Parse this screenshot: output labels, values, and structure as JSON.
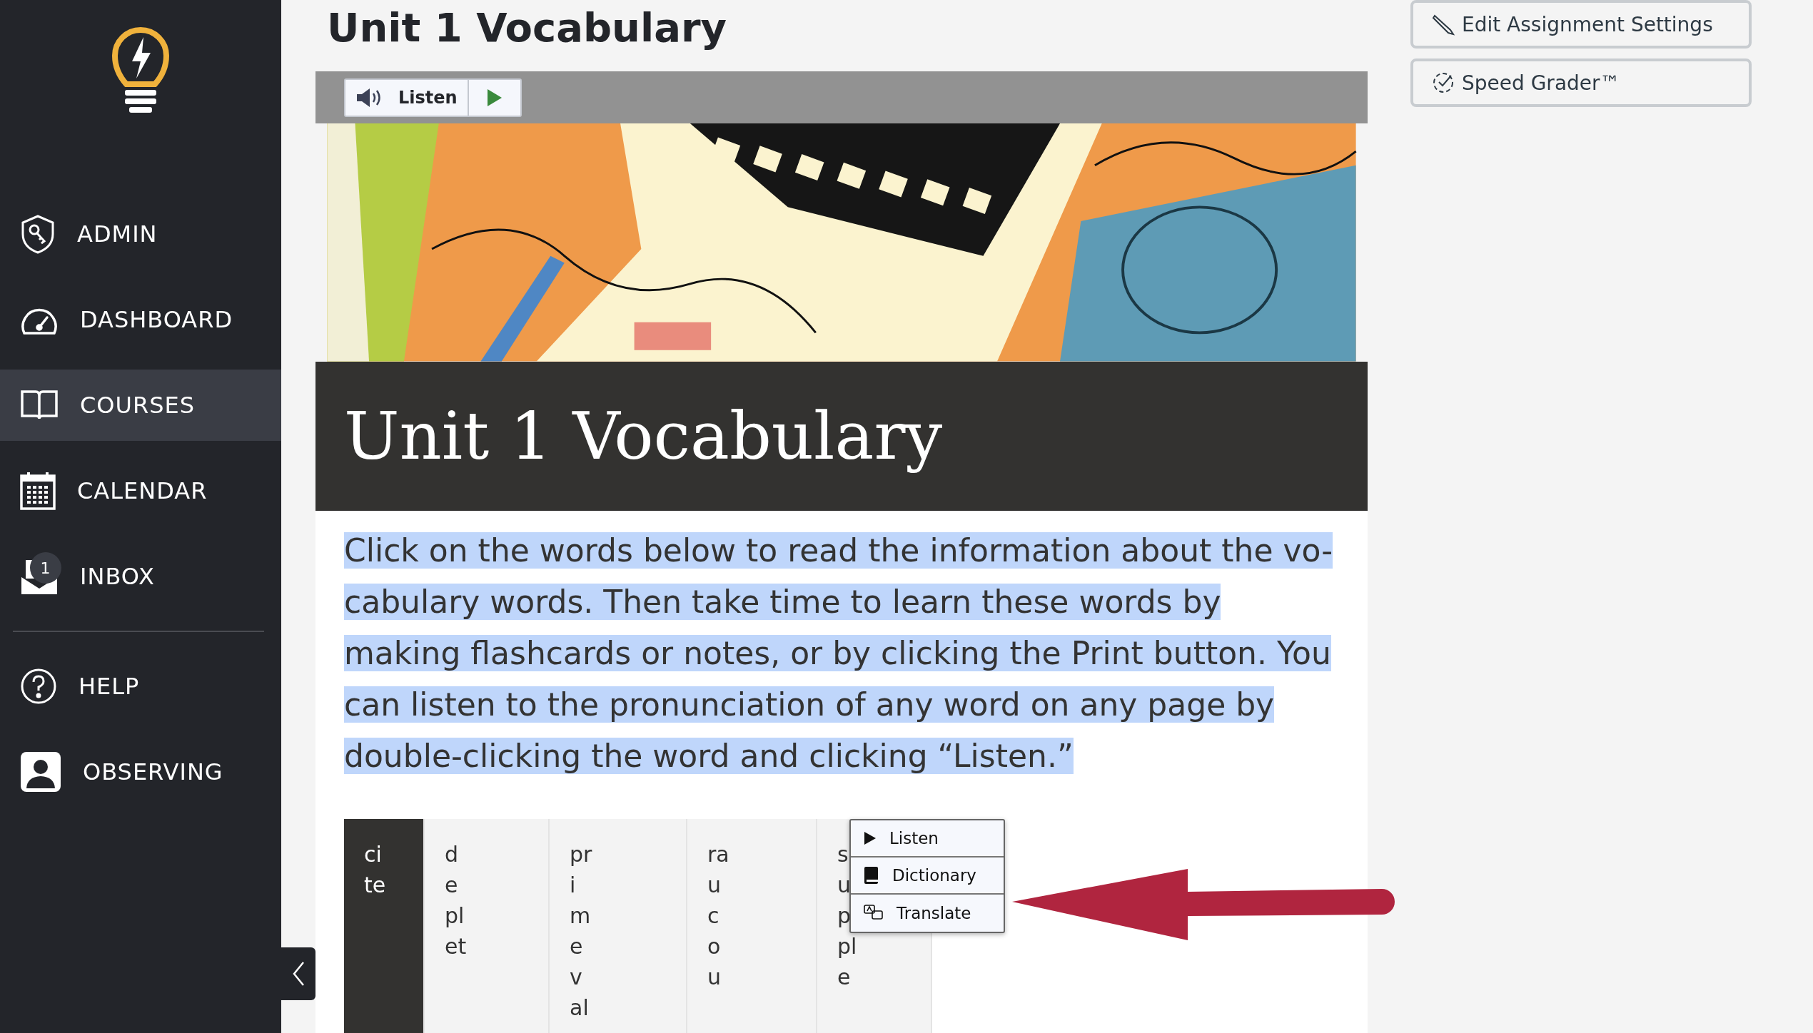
{
  "sidebar": {
    "items": [
      {
        "kind": "admin",
        "label": "ADMIN",
        "selected": false
      },
      {
        "kind": "dashboard",
        "label": "DASHBOARD",
        "selected": false
      },
      {
        "kind": "courses",
        "label": "COURSES",
        "selected": true
      },
      {
        "kind": "calendar",
        "label": "CALENDAR",
        "selected": false
      },
      {
        "kind": "inbox",
        "label": "INBOX",
        "selected": false,
        "badge": "1"
      },
      {
        "kind": "divider"
      },
      {
        "kind": "help",
        "label": "HELP",
        "selected": false
      },
      {
        "kind": "observing",
        "label": "OBSERVING",
        "selected": false
      }
    ]
  },
  "page_title": "Unit 1 Vocabulary",
  "listen_bar": {
    "label": "Listen"
  },
  "banner": {
    "title": "Unit 1 Vocabulary"
  },
  "intro": {
    "text": "Click on the words below to read the information about the vo-cabulary words. Then take time to learn these words by making flashcards or notes, or by clicking the Print button. You can listen to the pronunciation of any word on any page by double-clicking the word and clicking “Listen.”",
    "highlighted": true
  },
  "word_tabs": [
    {
      "label": "cite",
      "selected": true
    },
    {
      "label": "deplet",
      "selected": false
    },
    {
      "label": "primeval",
      "selected": false
    },
    {
      "label": "raucou",
      "selected": false
    },
    {
      "label": "supple",
      "selected": false
    }
  ],
  "context_menu": [
    {
      "kind": "listen",
      "label": "Listen"
    },
    {
      "kind": "dictionary",
      "label": "Dictionary"
    },
    {
      "kind": "translate",
      "label": "Translate"
    }
  ],
  "actions": [
    {
      "kind": "edit",
      "label": "Edit Assignment Settings"
    },
    {
      "kind": "grader",
      "label": "Speed Grader™"
    }
  ]
}
